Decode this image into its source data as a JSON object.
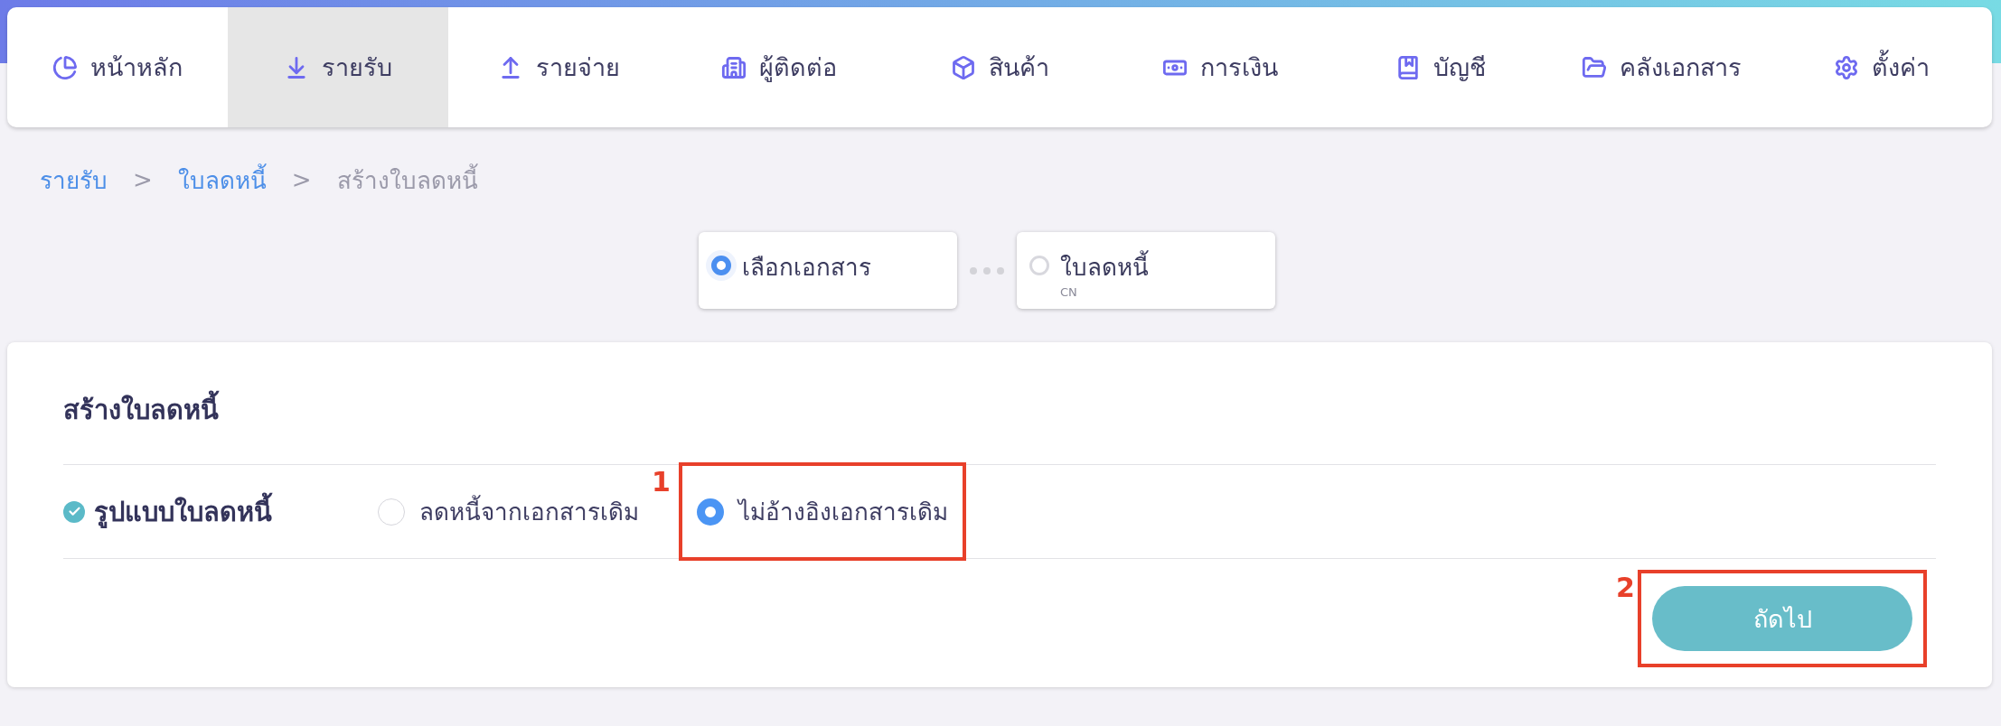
{
  "nav": [
    {
      "label": "หน้าหลัก",
      "selected": false
    },
    {
      "label": "รายรับ",
      "selected": true
    },
    {
      "label": "รายจ่าย",
      "selected": false
    },
    {
      "label": "ผู้ติดต่อ",
      "selected": false
    },
    {
      "label": "สินค้า",
      "selected": false
    },
    {
      "label": "การเงิน",
      "selected": false
    },
    {
      "label": "บัญชี",
      "selected": false
    },
    {
      "label": "คลังเอกสาร",
      "selected": false
    },
    {
      "label": "ตั้งค่า",
      "selected": false
    }
  ],
  "breadcrumb": [
    {
      "label": "รายรับ",
      "kind": "link"
    },
    {
      "label": ">",
      "kind": "separator"
    },
    {
      "label": "ใบลดหนี้",
      "kind": "link"
    },
    {
      "label": ">",
      "kind": "separator"
    },
    {
      "label": "สร้างใบลดหนี้",
      "kind": "current"
    }
  ],
  "steps": [
    {
      "label": "เลือกเอกสาร",
      "selected": true
    },
    {
      "label": "ใบลดหนี้",
      "sublabel": "CN",
      "selected": false
    }
  ],
  "form": {
    "title": "สร้างใบลดหนี้",
    "field_label": "รูปแบบใบลดหนี้",
    "field_done": true,
    "options": [
      {
        "label": "ลดหนี้จากเอกสารเดิม",
        "selected": false
      },
      {
        "label": "ไม่อ้างอิงเอกสารเดิม",
        "selected": true,
        "annotation": "1"
      }
    ],
    "next_button": {
      "label": "ถัดไป",
      "annotation": "2"
    }
  }
}
